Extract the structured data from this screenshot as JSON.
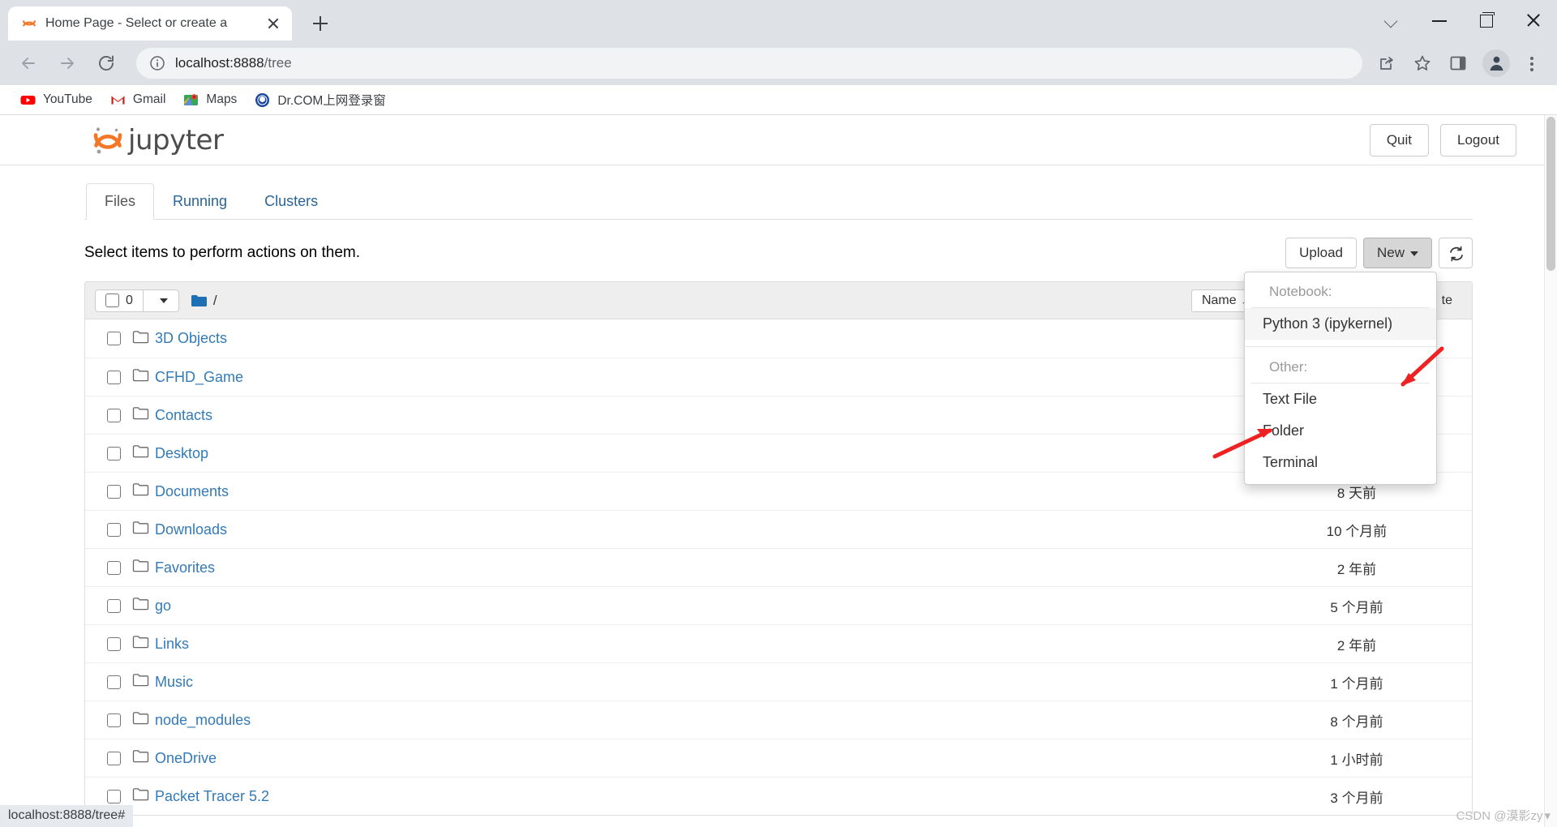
{
  "browser": {
    "tab": {
      "title": "Home Page - Select or create a",
      "favicon": "jupyter-logo-icon",
      "close": "×"
    },
    "new_tab_label": "+",
    "window_controls": {
      "minimize": "—",
      "maximize": "❐",
      "close": "✕",
      "chevron": "⌄"
    },
    "nav": {
      "back": "←",
      "forward": "→",
      "reload": "⟳"
    },
    "omnibox": {
      "info_icon": "info-circle-icon",
      "url_host": "localhost:8888",
      "url_path": "/tree"
    },
    "toolbar_icons": [
      "share-icon",
      "star-icon",
      "sidepanel-icon",
      "profile-avatar-icon",
      "kebab-menu-icon"
    ],
    "bookmarks": [
      {
        "label": "YouTube",
        "icon": "youtube-icon"
      },
      {
        "label": "Gmail",
        "icon": "gmail-icon"
      },
      {
        "label": "Maps",
        "icon": "google-maps-icon"
      },
      {
        "label": "Dr.COM上网登录窗",
        "icon": "drcom-icon"
      }
    ],
    "status_bar": "localhost:8888/tree#"
  },
  "jupyter": {
    "logo_text": "jupyter",
    "header_buttons": {
      "quit": "Quit",
      "logout": "Logout"
    },
    "tabs": [
      {
        "label": "Files",
        "active": true
      },
      {
        "label": "Running",
        "active": false
      },
      {
        "label": "Clusters",
        "active": false
      }
    ],
    "action_text": "Select items to perform actions on them.",
    "buttons": {
      "upload": "Upload",
      "new": "New",
      "refresh": "refresh-icon"
    },
    "new_menu": {
      "notebook_header": "Notebook:",
      "notebook_items": [
        "Python 3 (ipykernel)"
      ],
      "other_header": "Other:",
      "other_items": [
        "Text File",
        "Folder",
        "Terminal"
      ]
    },
    "list_toolbar": {
      "selected_count": "0",
      "path": "/",
      "sort_label": "Name",
      "sort_direction": "↓",
      "last_modified_label": "te"
    },
    "files": [
      {
        "name": "3D Objects",
        "type": "folder",
        "modified": ""
      },
      {
        "name": "CFHD_Game",
        "type": "folder",
        "modified": ""
      },
      {
        "name": "Contacts",
        "type": "folder",
        "modified": ""
      },
      {
        "name": "Desktop",
        "type": "folder",
        "modified": ""
      },
      {
        "name": "Documents",
        "type": "folder",
        "modified": "8 天前"
      },
      {
        "name": "Downloads",
        "type": "folder",
        "modified": "10 个月前"
      },
      {
        "name": "Favorites",
        "type": "folder",
        "modified": "2 年前"
      },
      {
        "name": "go",
        "type": "folder",
        "modified": "5 个月前"
      },
      {
        "name": "Links",
        "type": "folder",
        "modified": "2 年前"
      },
      {
        "name": "Music",
        "type": "folder",
        "modified": "1 个月前"
      },
      {
        "name": "node_modules",
        "type": "folder",
        "modified": "8 个月前"
      },
      {
        "name": "OneDrive",
        "type": "folder",
        "modified": "1 小时前"
      },
      {
        "name": "Packet Tracer 5.2",
        "type": "folder",
        "modified": "3 个月前"
      }
    ]
  },
  "watermark": "CSDN @漠影zy",
  "colors": {
    "jupyter_orange": "#f37726",
    "link_blue": "#337ab7",
    "annotation_red": "#ee2222",
    "chrome_grey": "#dee1e6"
  }
}
